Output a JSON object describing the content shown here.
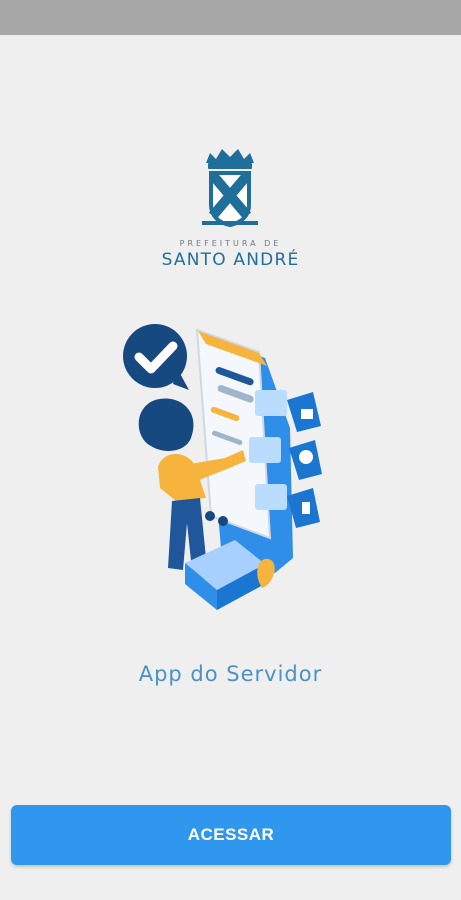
{
  "status_bar": {
    "color": "#a7a7a7"
  },
  "logo": {
    "emblem_icon": "santo-andre-coat-of-arms",
    "subtitle": "PREFEITURA DE",
    "title": "SANTO ANDRÉ"
  },
  "illustration": {
    "icon": "woman-with-phone-checkmark-illustration"
  },
  "app": {
    "title": "App do Servidor"
  },
  "actions": {
    "access_label": "ACESSAR"
  },
  "colors": {
    "background": "#efefef",
    "primary_button": "#2f97ee",
    "title_text": "#4a92c8",
    "logo_blue": "#1f6f9a"
  }
}
